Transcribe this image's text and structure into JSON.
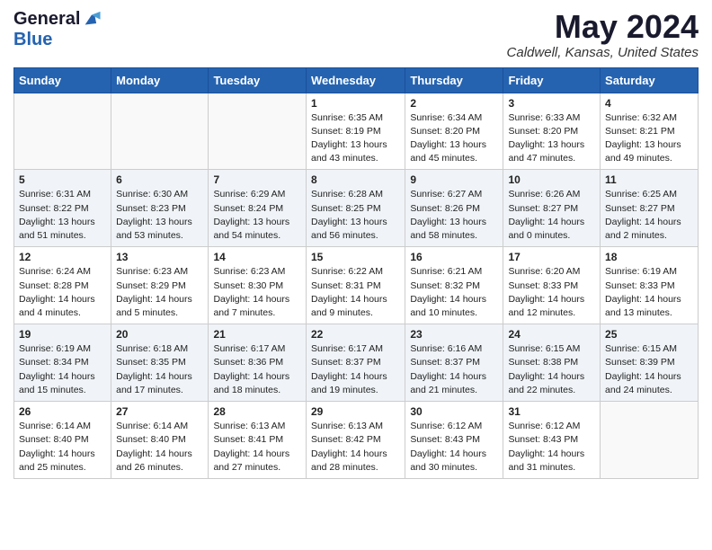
{
  "header": {
    "logo_general": "General",
    "logo_blue": "Blue",
    "title": "May 2024",
    "location": "Caldwell, Kansas, United States"
  },
  "days_of_week": [
    "Sunday",
    "Monday",
    "Tuesday",
    "Wednesday",
    "Thursday",
    "Friday",
    "Saturday"
  ],
  "weeks": [
    [
      {
        "day": "",
        "info": ""
      },
      {
        "day": "",
        "info": ""
      },
      {
        "day": "",
        "info": ""
      },
      {
        "day": "1",
        "info": "Sunrise: 6:35 AM\nSunset: 8:19 PM\nDaylight: 13 hours\nand 43 minutes."
      },
      {
        "day": "2",
        "info": "Sunrise: 6:34 AM\nSunset: 8:20 PM\nDaylight: 13 hours\nand 45 minutes."
      },
      {
        "day": "3",
        "info": "Sunrise: 6:33 AM\nSunset: 8:20 PM\nDaylight: 13 hours\nand 47 minutes."
      },
      {
        "day": "4",
        "info": "Sunrise: 6:32 AM\nSunset: 8:21 PM\nDaylight: 13 hours\nand 49 minutes."
      }
    ],
    [
      {
        "day": "5",
        "info": "Sunrise: 6:31 AM\nSunset: 8:22 PM\nDaylight: 13 hours\nand 51 minutes."
      },
      {
        "day": "6",
        "info": "Sunrise: 6:30 AM\nSunset: 8:23 PM\nDaylight: 13 hours\nand 53 minutes."
      },
      {
        "day": "7",
        "info": "Sunrise: 6:29 AM\nSunset: 8:24 PM\nDaylight: 13 hours\nand 54 minutes."
      },
      {
        "day": "8",
        "info": "Sunrise: 6:28 AM\nSunset: 8:25 PM\nDaylight: 13 hours\nand 56 minutes."
      },
      {
        "day": "9",
        "info": "Sunrise: 6:27 AM\nSunset: 8:26 PM\nDaylight: 13 hours\nand 58 minutes."
      },
      {
        "day": "10",
        "info": "Sunrise: 6:26 AM\nSunset: 8:27 PM\nDaylight: 14 hours\nand 0 minutes."
      },
      {
        "day": "11",
        "info": "Sunrise: 6:25 AM\nSunset: 8:27 PM\nDaylight: 14 hours\nand 2 minutes."
      }
    ],
    [
      {
        "day": "12",
        "info": "Sunrise: 6:24 AM\nSunset: 8:28 PM\nDaylight: 14 hours\nand 4 minutes."
      },
      {
        "day": "13",
        "info": "Sunrise: 6:23 AM\nSunset: 8:29 PM\nDaylight: 14 hours\nand 5 minutes."
      },
      {
        "day": "14",
        "info": "Sunrise: 6:23 AM\nSunset: 8:30 PM\nDaylight: 14 hours\nand 7 minutes."
      },
      {
        "day": "15",
        "info": "Sunrise: 6:22 AM\nSunset: 8:31 PM\nDaylight: 14 hours\nand 9 minutes."
      },
      {
        "day": "16",
        "info": "Sunrise: 6:21 AM\nSunset: 8:32 PM\nDaylight: 14 hours\nand 10 minutes."
      },
      {
        "day": "17",
        "info": "Sunrise: 6:20 AM\nSunset: 8:33 PM\nDaylight: 14 hours\nand 12 minutes."
      },
      {
        "day": "18",
        "info": "Sunrise: 6:19 AM\nSunset: 8:33 PM\nDaylight: 14 hours\nand 13 minutes."
      }
    ],
    [
      {
        "day": "19",
        "info": "Sunrise: 6:19 AM\nSunset: 8:34 PM\nDaylight: 14 hours\nand 15 minutes."
      },
      {
        "day": "20",
        "info": "Sunrise: 6:18 AM\nSunset: 8:35 PM\nDaylight: 14 hours\nand 17 minutes."
      },
      {
        "day": "21",
        "info": "Sunrise: 6:17 AM\nSunset: 8:36 PM\nDaylight: 14 hours\nand 18 minutes."
      },
      {
        "day": "22",
        "info": "Sunrise: 6:17 AM\nSunset: 8:37 PM\nDaylight: 14 hours\nand 19 minutes."
      },
      {
        "day": "23",
        "info": "Sunrise: 6:16 AM\nSunset: 8:37 PM\nDaylight: 14 hours\nand 21 minutes."
      },
      {
        "day": "24",
        "info": "Sunrise: 6:15 AM\nSunset: 8:38 PM\nDaylight: 14 hours\nand 22 minutes."
      },
      {
        "day": "25",
        "info": "Sunrise: 6:15 AM\nSunset: 8:39 PM\nDaylight: 14 hours\nand 24 minutes."
      }
    ],
    [
      {
        "day": "26",
        "info": "Sunrise: 6:14 AM\nSunset: 8:40 PM\nDaylight: 14 hours\nand 25 minutes."
      },
      {
        "day": "27",
        "info": "Sunrise: 6:14 AM\nSunset: 8:40 PM\nDaylight: 14 hours\nand 26 minutes."
      },
      {
        "day": "28",
        "info": "Sunrise: 6:13 AM\nSunset: 8:41 PM\nDaylight: 14 hours\nand 27 minutes."
      },
      {
        "day": "29",
        "info": "Sunrise: 6:13 AM\nSunset: 8:42 PM\nDaylight: 14 hours\nand 28 minutes."
      },
      {
        "day": "30",
        "info": "Sunrise: 6:12 AM\nSunset: 8:43 PM\nDaylight: 14 hours\nand 30 minutes."
      },
      {
        "day": "31",
        "info": "Sunrise: 6:12 AM\nSunset: 8:43 PM\nDaylight: 14 hours\nand 31 minutes."
      },
      {
        "day": "",
        "info": ""
      }
    ]
  ]
}
